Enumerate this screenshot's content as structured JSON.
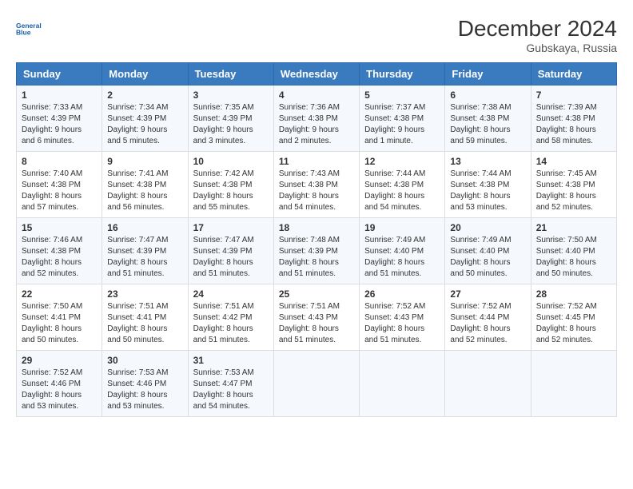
{
  "header": {
    "logo_line1": "General",
    "logo_line2": "Blue",
    "title": "December 2024",
    "subtitle": "Gubskaya, Russia"
  },
  "days_of_week": [
    "Sunday",
    "Monday",
    "Tuesday",
    "Wednesday",
    "Thursday",
    "Friday",
    "Saturday"
  ],
  "weeks": [
    [
      {
        "day": 1,
        "sunrise": "7:33 AM",
        "sunset": "4:39 PM",
        "daylight": "9 hours and 6 minutes."
      },
      {
        "day": 2,
        "sunrise": "7:34 AM",
        "sunset": "4:39 PM",
        "daylight": "9 hours and 5 minutes."
      },
      {
        "day": 3,
        "sunrise": "7:35 AM",
        "sunset": "4:39 PM",
        "daylight": "9 hours and 3 minutes."
      },
      {
        "day": 4,
        "sunrise": "7:36 AM",
        "sunset": "4:38 PM",
        "daylight": "9 hours and 2 minutes."
      },
      {
        "day": 5,
        "sunrise": "7:37 AM",
        "sunset": "4:38 PM",
        "daylight": "9 hours and 1 minute."
      },
      {
        "day": 6,
        "sunrise": "7:38 AM",
        "sunset": "4:38 PM",
        "daylight": "8 hours and 59 minutes."
      },
      {
        "day": 7,
        "sunrise": "7:39 AM",
        "sunset": "4:38 PM",
        "daylight": "8 hours and 58 minutes."
      }
    ],
    [
      {
        "day": 8,
        "sunrise": "7:40 AM",
        "sunset": "4:38 PM",
        "daylight": "8 hours and 57 minutes."
      },
      {
        "day": 9,
        "sunrise": "7:41 AM",
        "sunset": "4:38 PM",
        "daylight": "8 hours and 56 minutes."
      },
      {
        "day": 10,
        "sunrise": "7:42 AM",
        "sunset": "4:38 PM",
        "daylight": "8 hours and 55 minutes."
      },
      {
        "day": 11,
        "sunrise": "7:43 AM",
        "sunset": "4:38 PM",
        "daylight": "8 hours and 54 minutes."
      },
      {
        "day": 12,
        "sunrise": "7:44 AM",
        "sunset": "4:38 PM",
        "daylight": "8 hours and 54 minutes."
      },
      {
        "day": 13,
        "sunrise": "7:44 AM",
        "sunset": "4:38 PM",
        "daylight": "8 hours and 53 minutes."
      },
      {
        "day": 14,
        "sunrise": "7:45 AM",
        "sunset": "4:38 PM",
        "daylight": "8 hours and 52 minutes."
      }
    ],
    [
      {
        "day": 15,
        "sunrise": "7:46 AM",
        "sunset": "4:38 PM",
        "daylight": "8 hours and 52 minutes."
      },
      {
        "day": 16,
        "sunrise": "7:47 AM",
        "sunset": "4:39 PM",
        "daylight": "8 hours and 51 minutes."
      },
      {
        "day": 17,
        "sunrise": "7:47 AM",
        "sunset": "4:39 PM",
        "daylight": "8 hours and 51 minutes."
      },
      {
        "day": 18,
        "sunrise": "7:48 AM",
        "sunset": "4:39 PM",
        "daylight": "8 hours and 51 minutes."
      },
      {
        "day": 19,
        "sunrise": "7:49 AM",
        "sunset": "4:40 PM",
        "daylight": "8 hours and 51 minutes."
      },
      {
        "day": 20,
        "sunrise": "7:49 AM",
        "sunset": "4:40 PM",
        "daylight": "8 hours and 50 minutes."
      },
      {
        "day": 21,
        "sunrise": "7:50 AM",
        "sunset": "4:40 PM",
        "daylight": "8 hours and 50 minutes."
      }
    ],
    [
      {
        "day": 22,
        "sunrise": "7:50 AM",
        "sunset": "4:41 PM",
        "daylight": "8 hours and 50 minutes."
      },
      {
        "day": 23,
        "sunrise": "7:51 AM",
        "sunset": "4:41 PM",
        "daylight": "8 hours and 50 minutes."
      },
      {
        "day": 24,
        "sunrise": "7:51 AM",
        "sunset": "4:42 PM",
        "daylight": "8 hours and 51 minutes."
      },
      {
        "day": 25,
        "sunrise": "7:51 AM",
        "sunset": "4:43 PM",
        "daylight": "8 hours and 51 minutes."
      },
      {
        "day": 26,
        "sunrise": "7:52 AM",
        "sunset": "4:43 PM",
        "daylight": "8 hours and 51 minutes."
      },
      {
        "day": 27,
        "sunrise": "7:52 AM",
        "sunset": "4:44 PM",
        "daylight": "8 hours and 52 minutes."
      },
      {
        "day": 28,
        "sunrise": "7:52 AM",
        "sunset": "4:45 PM",
        "daylight": "8 hours and 52 minutes."
      }
    ],
    [
      {
        "day": 29,
        "sunrise": "7:52 AM",
        "sunset": "4:46 PM",
        "daylight": "8 hours and 53 minutes."
      },
      {
        "day": 30,
        "sunrise": "7:53 AM",
        "sunset": "4:46 PM",
        "daylight": "8 hours and 53 minutes."
      },
      {
        "day": 31,
        "sunrise": "7:53 AM",
        "sunset": "4:47 PM",
        "daylight": "8 hours and 54 minutes."
      },
      null,
      null,
      null,
      null
    ]
  ]
}
